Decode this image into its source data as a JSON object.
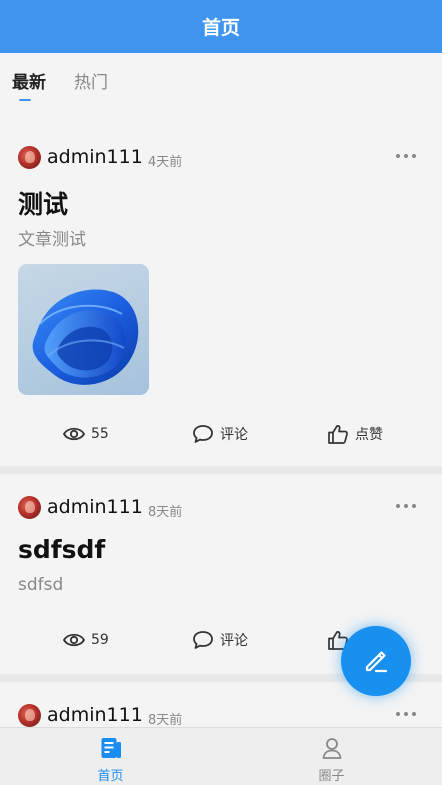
{
  "header": {
    "title": "首页"
  },
  "tabs": [
    {
      "label": "最新",
      "active": true
    },
    {
      "label": "热门",
      "active": false
    }
  ],
  "posts": [
    {
      "author": "admin111",
      "time": "4天前",
      "title": "测试",
      "summary": "文章测试",
      "has_image": true,
      "views": "55",
      "comment_label": "评论",
      "like_label": "点赞"
    },
    {
      "author": "admin111",
      "time": "8天前",
      "title": "sdfsdf",
      "summary": "sdfsd",
      "has_image": false,
      "views": "59",
      "comment_label": "评论",
      "like_label": "点赞"
    },
    {
      "author": "admin111",
      "time": "8天前"
    }
  ],
  "fab": {
    "icon": "edit-pencil-icon",
    "color": "#1890f0"
  },
  "bottom_nav": [
    {
      "label": "首页",
      "icon": "document-icon",
      "active": true
    },
    {
      "label": "圈子",
      "icon": "user-icon",
      "active": false
    }
  ],
  "colors": {
    "accent": "#3f95ee",
    "active_nav": "#1a8df0"
  }
}
